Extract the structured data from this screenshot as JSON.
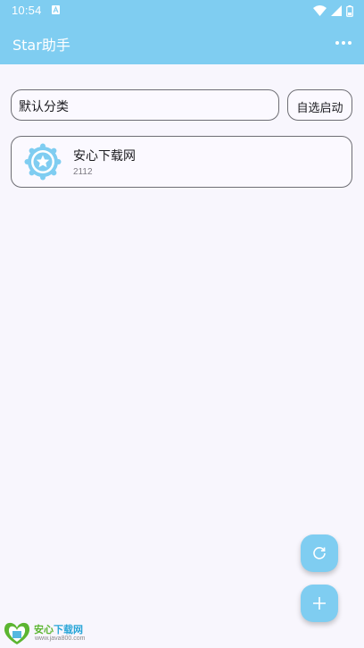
{
  "status_bar": {
    "time": "10:54",
    "left_icon": "a-letter-icon",
    "right_icons": [
      "wifi-icon",
      "signal-icon",
      "battery-icon"
    ]
  },
  "app_bar": {
    "title": "Star助手",
    "more_icon": "more-dots-icon"
  },
  "category": {
    "value": "默认分类"
  },
  "launch_button": {
    "label": "自选启动"
  },
  "list": [
    {
      "title": "安心下载网",
      "subtitle": "2112",
      "icon": "star-badge-icon"
    }
  ],
  "fabs": {
    "refresh_icon": "refresh-icon",
    "add_icon": "plus-icon"
  },
  "watermark": {
    "name_part1": "安心",
    "name_part2": "下载网",
    "url": "www.java800.com"
  },
  "colors": {
    "accent": "#7fcdf1",
    "background": "#f8f6fd",
    "border": "#6e6e74"
  }
}
